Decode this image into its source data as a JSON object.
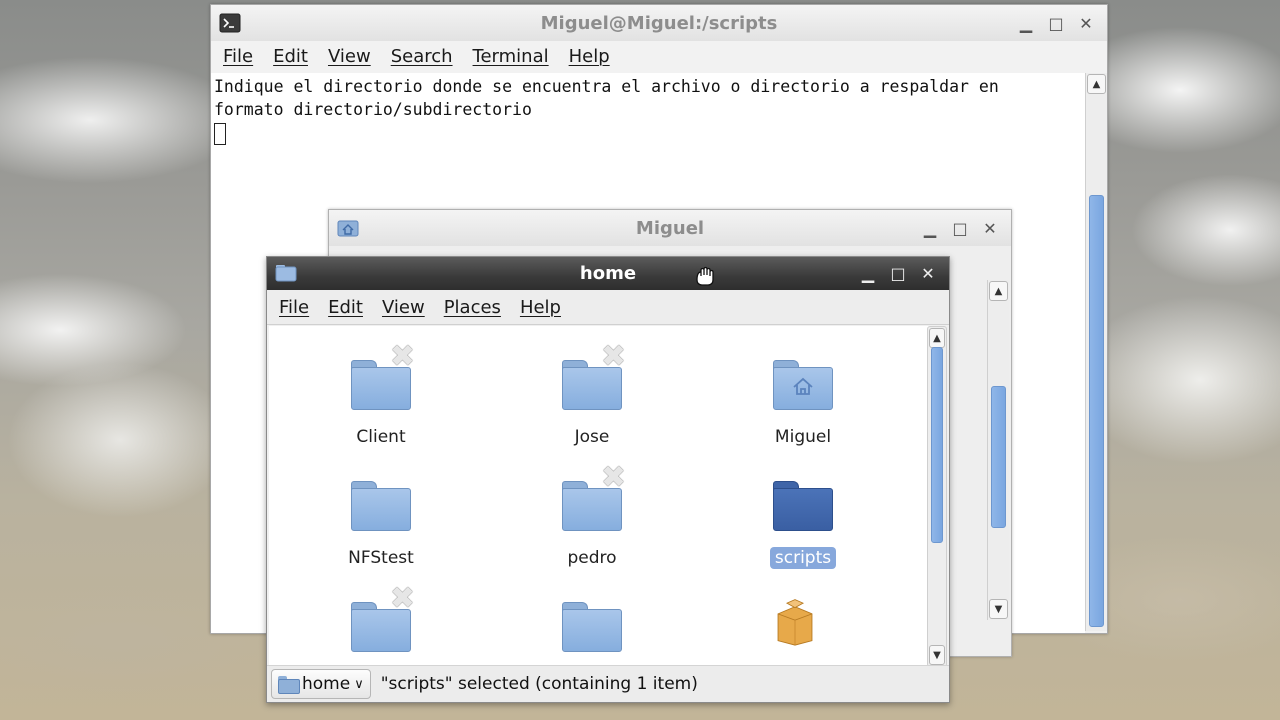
{
  "terminal": {
    "title": "Miguel@Miguel:/scripts",
    "menu": [
      "File",
      "Edit",
      "View",
      "Search",
      "Terminal",
      "Help"
    ],
    "lines": [
      "Indique el directorio donde se encuentra el archivo o directorio a respaldar en",
      "formato directorio/subdirectorio"
    ],
    "scroll_position": 0.85
  },
  "miguel_window": {
    "title": "Miguel"
  },
  "home_window": {
    "title": "home",
    "menu": [
      "File",
      "Edit",
      "View",
      "Places",
      "Help"
    ],
    "items": [
      {
        "label": "Client",
        "icon": "folder-icon",
        "emblem": "unreadable-emblem"
      },
      {
        "label": "Jose",
        "icon": "folder-icon",
        "emblem": "unreadable-emblem"
      },
      {
        "label": "Miguel",
        "icon": "home-folder-icon",
        "emblem": ""
      },
      {
        "label": "NFStest",
        "icon": "folder-icon",
        "emblem": ""
      },
      {
        "label": "pedro",
        "icon": "folder-icon",
        "emblem": "unreadable-emblem"
      },
      {
        "label": "scripts",
        "icon": "folder-icon",
        "emblem": "",
        "selected": true
      },
      {
        "label": "",
        "icon": "folder-icon",
        "emblem": "unreadable-emblem"
      },
      {
        "label": "",
        "icon": "folder-icon",
        "emblem": ""
      },
      {
        "label": "",
        "icon": "package-icon",
        "emblem": ""
      }
    ],
    "status": {
      "location_button": "home",
      "text": "\"scripts\" selected (containing 1 item)"
    }
  },
  "colors": {
    "selection": "#87a8dc",
    "folder": "#a9c6ea",
    "scroll_thumb": "#8fb6e8",
    "active_titlebar": "#3a3a3a"
  }
}
